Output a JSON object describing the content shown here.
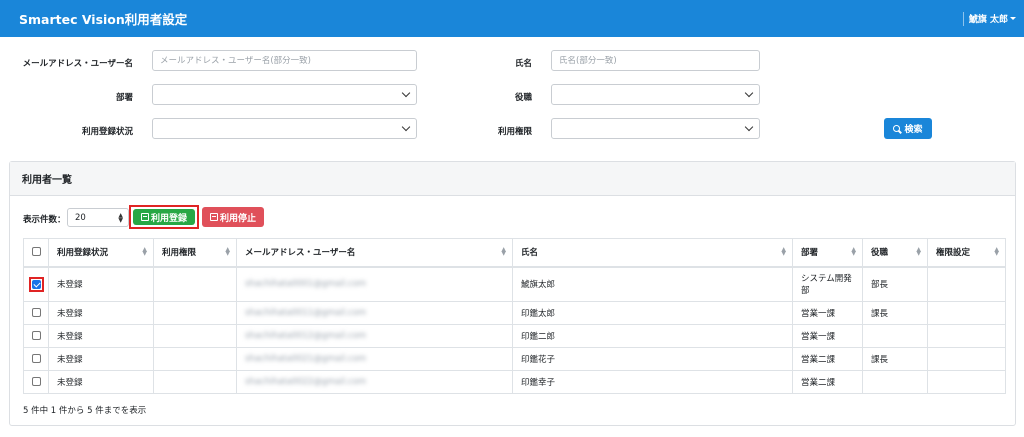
{
  "header": {
    "title": "Smartec Vision利用者設定",
    "user_name": "鯱旗 太郎"
  },
  "search": {
    "email_label": "メールアドレス・ユーザー名",
    "email_placeholder": "メールアドレス・ユーザー名(部分一致)",
    "name_label": "氏名",
    "name_placeholder": "氏名(部分一致)",
    "dept_label": "部署",
    "role_label": "役職",
    "status_label": "利用登録状況",
    "permission_label": "利用権限",
    "search_button": "検索"
  },
  "list": {
    "title": "利用者一覧",
    "per_page_label": "表示件数：",
    "per_page_value": "20",
    "register_button": "利用登録",
    "suspend_button": "利用停止",
    "columns": [
      "利用登録状況",
      "利用権限",
      "メールアドレス・ユーザー名",
      "氏名",
      "部署",
      "役職",
      "権限設定"
    ],
    "rows": [
      {
        "checked": true,
        "status": "未登録",
        "permission": "",
        "email": "shachihata0001@gmail.com",
        "name": "鯱旗太郎",
        "dept": "システム開発部",
        "role": "部長",
        "setting": ""
      },
      {
        "checked": false,
        "status": "未登録",
        "permission": "",
        "email": "shachihata0011@gmail.com",
        "name": "印鑑太郎",
        "dept": "営業一課",
        "role": "課長",
        "setting": ""
      },
      {
        "checked": false,
        "status": "未登録",
        "permission": "",
        "email": "shachihata0012@gmail.com",
        "name": "印鑑二郎",
        "dept": "営業一課",
        "role": "",
        "setting": ""
      },
      {
        "checked": false,
        "status": "未登録",
        "permission": "",
        "email": "shachihata0021@gmail.com",
        "name": "印鑑花子",
        "dept": "営業二課",
        "role": "課長",
        "setting": ""
      },
      {
        "checked": false,
        "status": "未登録",
        "permission": "",
        "email": "shachihata0022@gmail.com",
        "name": "印鑑幸子",
        "dept": "営業二課",
        "role": "",
        "setting": ""
      }
    ],
    "summary": "5 件中 1 件から 5 件までを表示"
  }
}
